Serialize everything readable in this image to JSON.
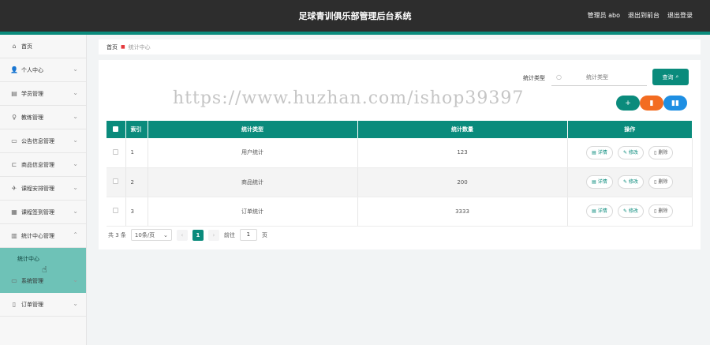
{
  "header": {
    "title": "足球青训俱乐部管理后台系统",
    "admin_label": "管理员 abo",
    "to_frontend": "退出到前台",
    "logout": "退出登录"
  },
  "sidebar": {
    "items": [
      {
        "label": "首页",
        "icon": "home-icon"
      },
      {
        "label": "个人中心",
        "icon": "user-icon"
      },
      {
        "label": "学员管理",
        "icon": "student-icon"
      },
      {
        "label": "教练管理",
        "icon": "coach-icon"
      },
      {
        "label": "公告信息管理",
        "icon": "notice-icon"
      },
      {
        "label": "商品信息管理",
        "icon": "goods-icon"
      },
      {
        "label": "课程安排管理",
        "icon": "course-icon"
      },
      {
        "label": "课程签到管理",
        "icon": "signin-icon"
      },
      {
        "label": "统计中心管理",
        "icon": "stats-icon"
      },
      {
        "label": "系统管理",
        "icon": "system-icon"
      },
      {
        "label": "订单管理",
        "icon": "order-icon"
      }
    ],
    "active_sub": "统计中心"
  },
  "breadcrumb": {
    "home": "首页",
    "current": "统计中心"
  },
  "search": {
    "label": "统计类型",
    "placeholder": "统计类型",
    "button": "查询"
  },
  "watermark": "https://www.huzhan.com/ishop39397",
  "actions": {
    "add": "+",
    "delete": "🗑",
    "chart": "📊"
  },
  "table": {
    "headers": [
      "",
      "索引",
      "统计类型",
      "统计数量",
      "操作"
    ],
    "rows": [
      {
        "index": "1",
        "type": "用户统计",
        "count": "123"
      },
      {
        "index": "2",
        "type": "商品统计",
        "count": "200"
      },
      {
        "index": "3",
        "type": "订单统计",
        "count": "3333"
      }
    ],
    "row_actions": {
      "detail": "详情",
      "edit": "修改",
      "remove": "删除"
    }
  },
  "pagination": {
    "total": "共 3 条",
    "page_size": "10条/页",
    "current_page": "1",
    "goto_label": "前往",
    "goto_value": "1",
    "page_unit": "页"
  },
  "colors": {
    "primary": "#0a8b7c",
    "topbar": "#2d2d2d",
    "danger": "#f36c21",
    "info": "#1e8fe3",
    "sidebar_active": "#6ec2b7"
  }
}
